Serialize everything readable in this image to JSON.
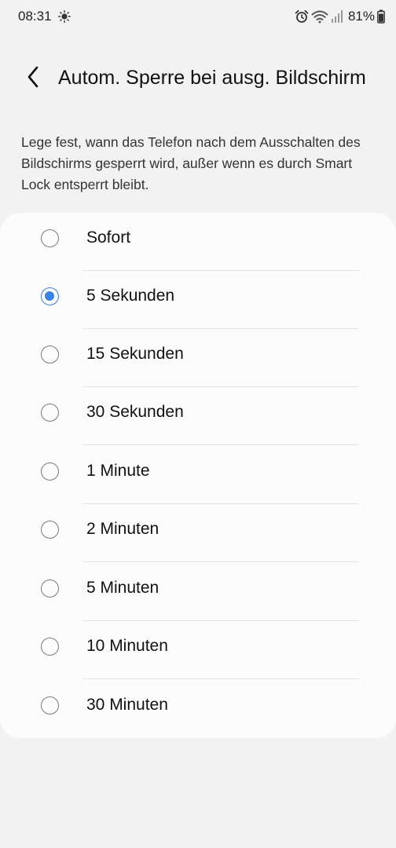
{
  "status_bar": {
    "time": "08:31",
    "battery": "81%",
    "icons": [
      "sun-icon",
      "alarm-icon",
      "wifi-icon",
      "signal-icon",
      "battery-icon"
    ]
  },
  "header": {
    "title": "Autom. Sperre bei ausg. Bildschirm",
    "back_icon": "chevron-left-icon"
  },
  "description": "Lege fest, wann das Telefon nach dem Ausschalten des Bildschirms gesperrt wird, außer wenn es durch Smart Lock entsperrt bleibt.",
  "options": [
    {
      "label": "Sofort",
      "selected": false
    },
    {
      "label": "5 Sekunden",
      "selected": true
    },
    {
      "label": "15 Sekunden",
      "selected": false
    },
    {
      "label": "30 Sekunden",
      "selected": false
    },
    {
      "label": "1 Minute",
      "selected": false
    },
    {
      "label": "2 Minuten",
      "selected": false
    },
    {
      "label": "5 Minuten",
      "selected": false
    },
    {
      "label": "10 Minuten",
      "selected": false
    },
    {
      "label": "30 Minuten",
      "selected": false
    }
  ],
  "colors": {
    "accent": "#3b82e6",
    "background": "#f2f2f2",
    "card": "#fcfcfc"
  }
}
